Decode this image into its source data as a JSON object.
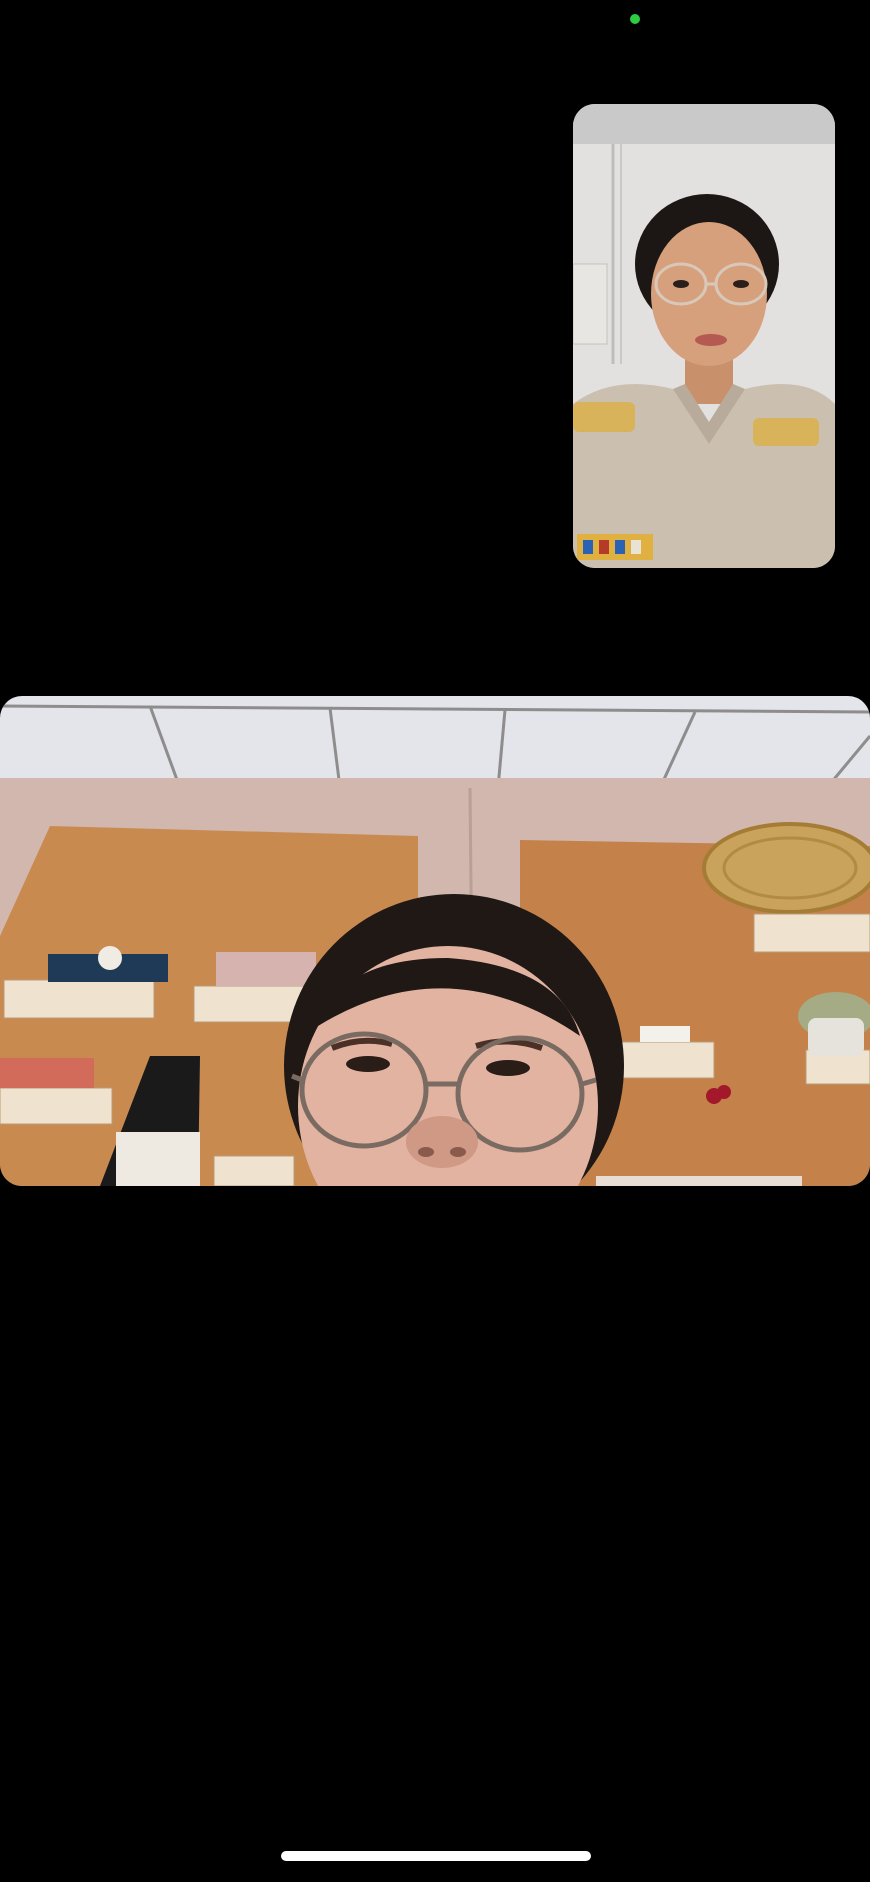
{
  "app": {
    "screen": "video-call"
  },
  "colors": {
    "background": "#000000",
    "camera_indicator": "#2ecc40",
    "home_indicator": "#ffffff",
    "self_wall": "#dcdcdc",
    "self_uniform": "#cfc3b4",
    "remote_ceiling": "#e4e6ea",
    "remote_wall": "#cfb5ad",
    "remote_board": "#c9894f"
  },
  "self_view": {
    "label": "self-camera-preview"
  },
  "remote_view": {
    "label": "remote-participant-video"
  }
}
